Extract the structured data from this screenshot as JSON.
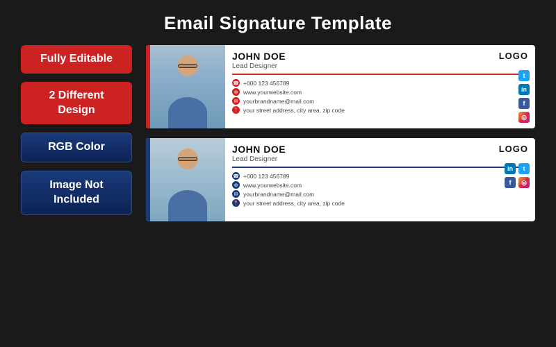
{
  "page": {
    "title": "Email Signature Template",
    "background": "#1a1a1a"
  },
  "badges": [
    {
      "id": "fully-editable",
      "text": "Fully Editable",
      "style": "red"
    },
    {
      "id": "two-designs",
      "text": "2 Different Design",
      "style": "red"
    },
    {
      "id": "rgb-color",
      "text": "RGB Color",
      "style": "blue"
    },
    {
      "id": "image-not-included",
      "text": "Image Not Included",
      "style": "blue"
    }
  ],
  "templates": [
    {
      "id": "template-red",
      "style": "red",
      "name": "JOHN DOE",
      "title": "Lead Designer",
      "logo": "LOGO",
      "phone": "+000 123 456789",
      "website": "www.yourwebsite.com",
      "email": "yourbrandname@mail.com",
      "address": "your street address, city area, zip code",
      "socials": [
        "tw",
        "in",
        "fb",
        "ig"
      ]
    },
    {
      "id": "template-blue",
      "style": "blue",
      "name": "JOHN DOE",
      "title": "Lead Designer",
      "logo": "LOGO",
      "phone": "+000 123 456789",
      "website": "www.yourwebsite.com",
      "email": "yourbrandname@mail.com",
      "address": "your street address, city area, zip code",
      "socials": [
        "in",
        "tw",
        "fb",
        "ig"
      ]
    }
  ]
}
